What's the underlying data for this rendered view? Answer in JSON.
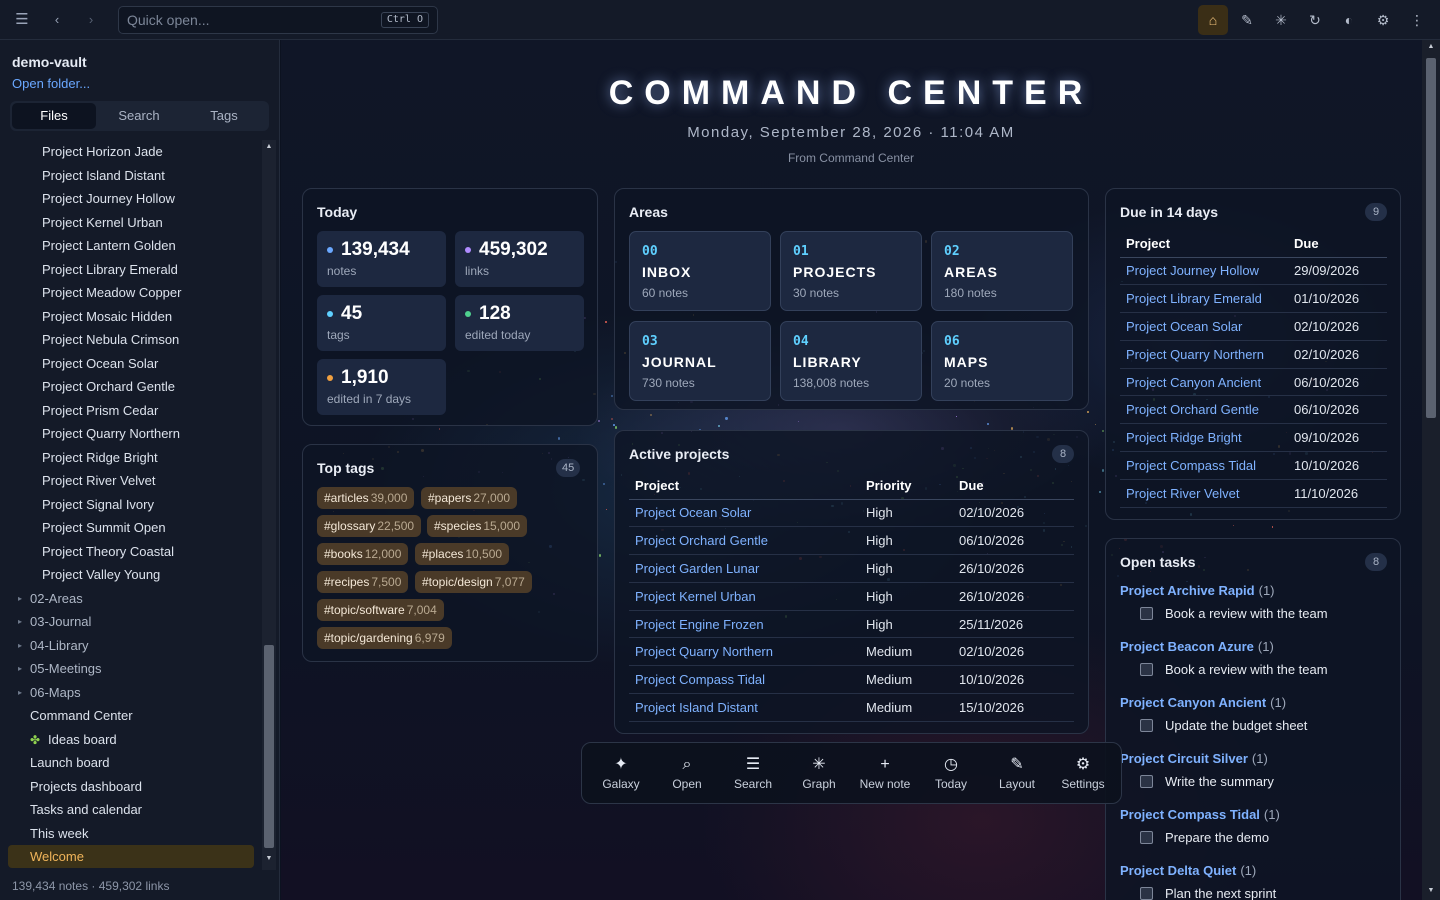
{
  "topbar": {
    "menu_icon": "hamburger-icon",
    "quick_open_placeholder": "Quick open...",
    "quick_open_shortcut": "Ctrl O",
    "right_icons": [
      "home-icon",
      "pencil-icon",
      "asterisk-icon",
      "refresh-icon",
      "contrast-icon",
      "gear-icon",
      "more-icon"
    ]
  },
  "sidebar": {
    "vault_name": "demo-vault",
    "open_folder": "Open folder...",
    "tabs": [
      "Files",
      "Search",
      "Tags"
    ],
    "active_tab": "Files",
    "files": [
      "Project Horizon Jade",
      "Project Island Distant",
      "Project Journey Hollow",
      "Project Kernel Urban",
      "Project Lantern Golden",
      "Project Library Emerald",
      "Project Meadow Copper",
      "Project Mosaic Hidden",
      "Project Nebula Crimson",
      "Project Ocean Solar",
      "Project Orchard Gentle",
      "Project Prism Cedar",
      "Project Quarry Northern",
      "Project Ridge Bright",
      "Project River Velvet",
      "Project Signal Ivory",
      "Project Summit Open",
      "Project Theory Coastal",
      "Project Valley Young"
    ],
    "folders": [
      "02-Areas",
      "03-Journal",
      "04-Library",
      "05-Meetings",
      "06-Maps"
    ],
    "root_notes": [
      "Command Center",
      "Ideas board",
      "Launch board",
      "Projects dashboard",
      "Tasks and calendar",
      "This week",
      "Welcome"
    ],
    "selected": "Welcome",
    "status": "139,434 notes · 459,302 links"
  },
  "header": {
    "title": "COMMAND CENTER",
    "date": "Monday, September 28, 2026 · 11:04 AM",
    "from": "From Command Center"
  },
  "today": {
    "title": "Today",
    "stats": [
      {
        "value": "139,434",
        "label": "notes",
        "color": "#6aa8ff"
      },
      {
        "value": "459,302",
        "label": "links",
        "color": "#b08cff"
      },
      {
        "value": "45",
        "label": "tags",
        "color": "#5fd0ff"
      },
      {
        "value": "128",
        "label": "edited today",
        "color": "#4fd18f"
      },
      {
        "value": "1,910",
        "label": "edited in 7 days",
        "color": "#f0a040"
      }
    ]
  },
  "areas": {
    "title": "Areas",
    "items": [
      {
        "code": "00",
        "name": "INBOX",
        "count": "60 notes"
      },
      {
        "code": "01",
        "name": "PROJECTS",
        "count": "30 notes"
      },
      {
        "code": "02",
        "name": "AREAS",
        "count": "180 notes"
      },
      {
        "code": "03",
        "name": "JOURNAL",
        "count": "730 notes"
      },
      {
        "code": "04",
        "name": "LIBRARY",
        "count": "138,008 notes"
      },
      {
        "code": "06",
        "name": "MAPS",
        "count": "20 notes"
      }
    ]
  },
  "top_tags": {
    "title": "Top tags",
    "badge": "45",
    "tags": [
      {
        "name": "#articles",
        "count": "39,000"
      },
      {
        "name": "#papers",
        "count": "27,000"
      },
      {
        "name": "#glossary",
        "count": "22,500"
      },
      {
        "name": "#species",
        "count": "15,000"
      },
      {
        "name": "#books",
        "count": "12,000"
      },
      {
        "name": "#places",
        "count": "10,500"
      },
      {
        "name": "#recipes",
        "count": "7,500"
      },
      {
        "name": "#topic/design",
        "count": "7,077"
      },
      {
        "name": "#topic/software",
        "count": "7,004"
      },
      {
        "name": "#topic/gardening",
        "count": "6,979"
      }
    ]
  },
  "active_projects": {
    "title": "Active projects",
    "badge": "8",
    "columns": [
      "Project",
      "Priority",
      "Due"
    ],
    "rows": [
      [
        "Project Ocean Solar",
        "High",
        "02/10/2026"
      ],
      [
        "Project Orchard Gentle",
        "High",
        "06/10/2026"
      ],
      [
        "Project Garden Lunar",
        "High",
        "26/10/2026"
      ],
      [
        "Project Kernel Urban",
        "High",
        "26/10/2026"
      ],
      [
        "Project Engine Frozen",
        "High",
        "25/11/2026"
      ],
      [
        "Project Quarry Northern",
        "Medium",
        "02/10/2026"
      ],
      [
        "Project Compass Tidal",
        "Medium",
        "10/10/2026"
      ],
      [
        "Project Island Distant",
        "Medium",
        "15/10/2026"
      ]
    ]
  },
  "due": {
    "title": "Due in 14 days",
    "badge": "9",
    "columns": [
      "Project",
      "Due"
    ],
    "rows": [
      [
        "Project Journey Hollow",
        "29/09/2026"
      ],
      [
        "Project Library Emerald",
        "01/10/2026"
      ],
      [
        "Project Ocean Solar",
        "02/10/2026"
      ],
      [
        "Project Quarry Northern",
        "02/10/2026"
      ],
      [
        "Project Canyon Ancient",
        "06/10/2026"
      ],
      [
        "Project Orchard Gentle",
        "06/10/2026"
      ],
      [
        "Project Ridge Bright",
        "09/10/2026"
      ],
      [
        "Project Compass Tidal",
        "10/10/2026"
      ],
      [
        "Project River Velvet",
        "11/10/2026"
      ]
    ]
  },
  "open_tasks": {
    "title": "Open tasks",
    "badge": "8",
    "groups": [
      {
        "project": "Project Archive Rapid",
        "count": "(1)",
        "task": "Book a review with the team"
      },
      {
        "project": "Project Beacon Azure",
        "count": "(1)",
        "task": "Book a review with the team"
      },
      {
        "project": "Project Canyon Ancient",
        "count": "(1)",
        "task": "Update the budget sheet"
      },
      {
        "project": "Project Circuit Silver",
        "count": "(1)",
        "task": "Write the summary"
      },
      {
        "project": "Project Compass Tidal",
        "count": "(1)",
        "task": "Prepare the demo"
      },
      {
        "project": "Project Delta Quiet",
        "count": "(1)",
        "task": "Plan the next sprint"
      }
    ]
  },
  "dock": {
    "buttons": [
      {
        "label": "Galaxy",
        "icon": "sparkle-icon"
      },
      {
        "label": "Open",
        "icon": "search-open-icon"
      },
      {
        "label": "Search",
        "icon": "lines-icon"
      },
      {
        "label": "Graph",
        "icon": "graph-icon"
      },
      {
        "label": "New note",
        "icon": "plus-icon"
      },
      {
        "label": "Today",
        "icon": "clock-icon"
      },
      {
        "label": "Layout",
        "icon": "pencil-icon"
      },
      {
        "label": "Settings",
        "icon": "gear-icon"
      }
    ]
  }
}
